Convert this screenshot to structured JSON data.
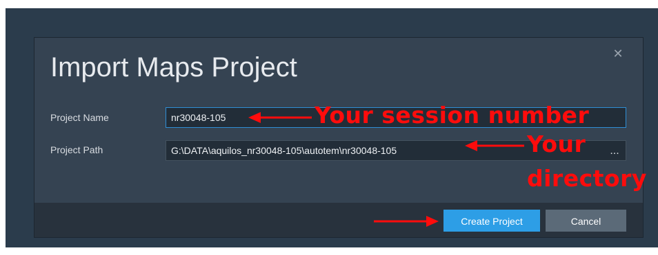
{
  "dialog": {
    "title": "Import Maps Project",
    "close_icon": "close-icon"
  },
  "form": {
    "project_name_label": "Project Name",
    "project_name_value": "nr30048-105",
    "project_path_label": "Project Path",
    "project_path_value": "G:\\DATA\\aquilos_nr30048-105\\autotem\\nr30048-105",
    "browse_label": "..."
  },
  "buttons": {
    "create_label": "Create Project",
    "cancel_label": "Cancel"
  },
  "annotations": {
    "session_number": "Your session number",
    "directory_line1": "Your",
    "directory_line2": "directory",
    "color": "#ff0c0c"
  },
  "colors": {
    "backdrop": "#2b3c4c",
    "dialog": "#354352",
    "footer": "#28323d",
    "primary": "#2d9ee6",
    "secondary": "#5b6a78"
  }
}
